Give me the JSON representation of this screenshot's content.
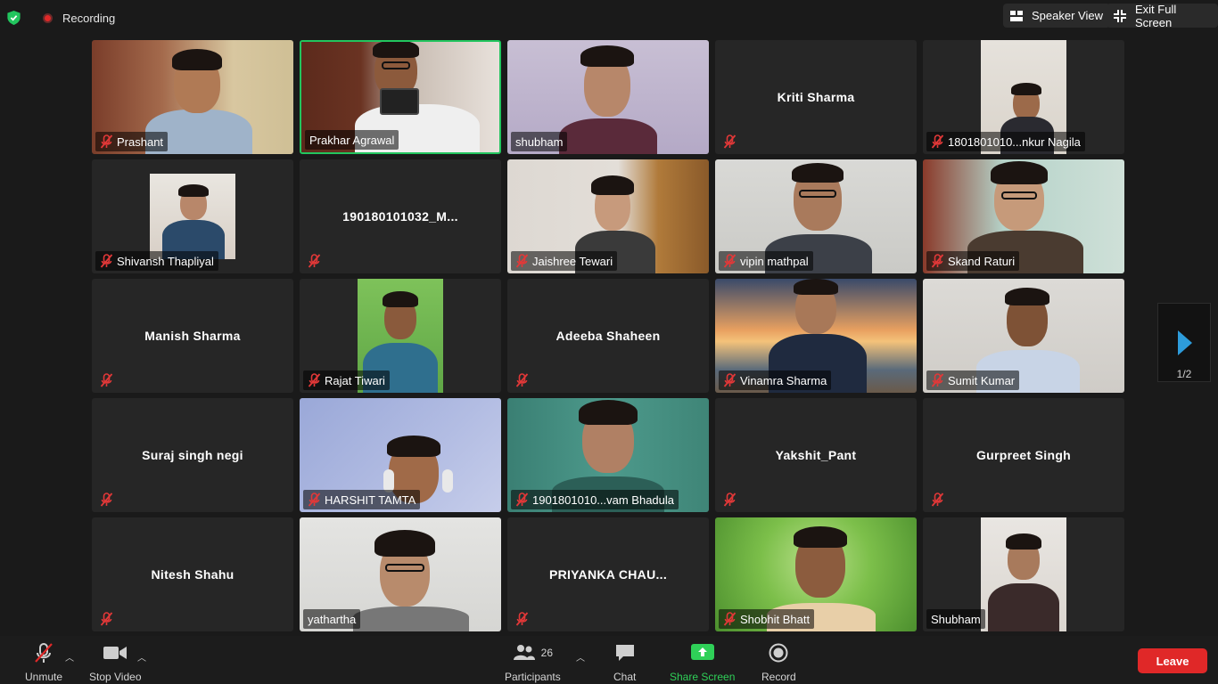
{
  "topbar": {
    "recording_label": "Recording",
    "speaker_view_label": "Speaker View",
    "exit_fullscreen_label": "Exit Full Screen"
  },
  "participants": [
    {
      "name": "Prashant",
      "video": true,
      "muted": true
    },
    {
      "name": "Prakhar Agrawal",
      "video": true,
      "muted": false,
      "active": true
    },
    {
      "name": "shubham",
      "video": true,
      "muted": false
    },
    {
      "name": "Kriti Sharma",
      "video": false,
      "muted": true
    },
    {
      "name": "1801801010...nkur Nagila",
      "video": true,
      "muted": true
    },
    {
      "name": "Shivansh Thapliyal",
      "video": true,
      "muted": true
    },
    {
      "name": "190180101032_M...",
      "video": false,
      "muted": true
    },
    {
      "name": "Jaishree Tewari",
      "video": true,
      "muted": true
    },
    {
      "name": "vipin mathpal",
      "video": true,
      "muted": true
    },
    {
      "name": "Skand Raturi",
      "video": true,
      "muted": true
    },
    {
      "name": "Manish Sharma",
      "video": false,
      "muted": true
    },
    {
      "name": "Rajat Tiwari",
      "video": true,
      "muted": true
    },
    {
      "name": "Adeeba Shaheen",
      "video": false,
      "muted": true
    },
    {
      "name": "Vinamra Sharma",
      "video": true,
      "muted": true
    },
    {
      "name": "Sumit Kumar",
      "video": true,
      "muted": true
    },
    {
      "name": "Suraj singh negi",
      "video": false,
      "muted": true
    },
    {
      "name": "HARSHIT TAMTA",
      "video": true,
      "muted": true
    },
    {
      "name": "1901801010...vam Bhadula",
      "video": true,
      "muted": true
    },
    {
      "name": "Yakshit_Pant",
      "video": false,
      "muted": true
    },
    {
      "name": "Gurpreet Singh",
      "video": false,
      "muted": true
    },
    {
      "name": "Nitesh Shahu",
      "video": false,
      "muted": true
    },
    {
      "name": "yathartha",
      "video": true,
      "muted": false
    },
    {
      "name": "PRIYANKA CHAU...",
      "video": false,
      "muted": true
    },
    {
      "name": "Shobhit Bhatt",
      "video": true,
      "muted": true
    },
    {
      "name": "Shubham",
      "video": true,
      "muted": false
    }
  ],
  "pager": {
    "label": "1/2"
  },
  "toolbar": {
    "unmute_label": "Unmute",
    "stop_video_label": "Stop Video",
    "participants_label": "Participants",
    "participants_count": "26",
    "chat_label": "Chat",
    "share_screen_label": "Share Screen",
    "record_label": "Record",
    "leave_label": "Leave"
  },
  "colors": {
    "active_border": "#22c55e",
    "share_green": "#2fd058",
    "leave_red": "#e02828",
    "next_arrow": "#2d9cdb"
  }
}
